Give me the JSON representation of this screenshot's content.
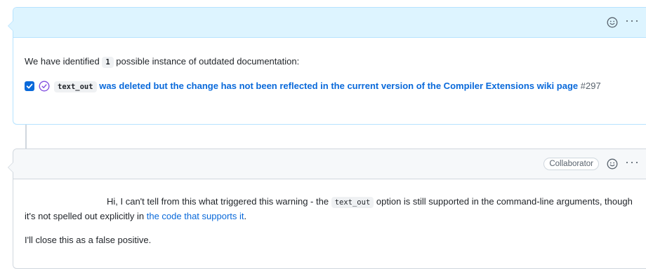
{
  "comment1": {
    "intro_before": "We have identified",
    "count": "1",
    "intro_after": "possible instance of outdated documentation:",
    "task": {
      "checked": true,
      "code": "text_out",
      "text": "was deleted but the change has not been reflected in the current version of the Compiler Extensions wiki page",
      "ref": "#297"
    }
  },
  "comment2": {
    "badge": "Collaborator",
    "para1_before": "Hi, I can't tell from this what triggered this warning - the",
    "para1_code": "text_out",
    "para1_mid": "option is still supported in the command-line arguments, though it's not spelled out explicitly in",
    "para1_link": "the code that supports it",
    "para1_end": ".",
    "para2": "I'll close this as a false positive."
  },
  "colors": {
    "accent": "#0969da",
    "header_blue": "#ddf4ff",
    "header_gray": "#f6f8fa",
    "border": "#d0d7de"
  },
  "icons": [
    "smiley-icon",
    "kebab-icon",
    "checkbox-icon",
    "issue-closed-icon"
  ]
}
